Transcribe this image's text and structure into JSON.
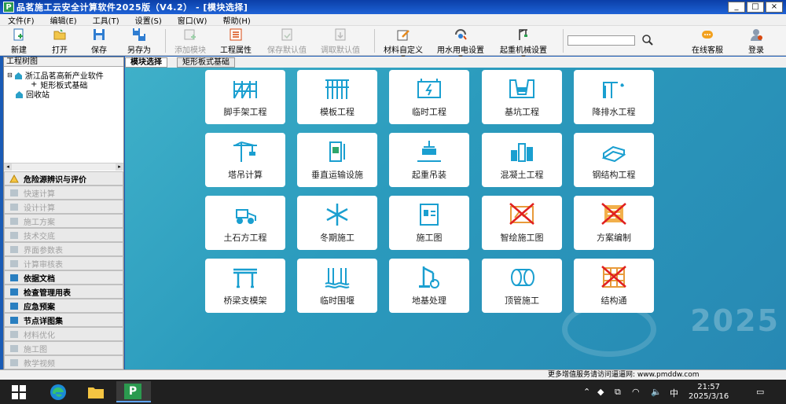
{
  "window": {
    "title": "品茗施工云安全计算软件2025版（V4.2） - [模块选择]",
    "app_icon_letter": "P",
    "minimize": "_",
    "maximize": "□",
    "close": "×"
  },
  "menu": [
    "文件(F)",
    "编辑(E)",
    "工具(T)",
    "设置(S)",
    "窗口(W)",
    "帮助(H)"
  ],
  "toolbar": {
    "new": "新建",
    "open": "打开",
    "save": "保存",
    "save_as": "另存为",
    "add_module": "添加模块",
    "project_props": "工程属性",
    "save_default": "保存默认值",
    "load_default": "调取默认值",
    "material_custom": "材料自定义",
    "water_power": "用水用电设置",
    "crane_setup": "起重机械设置",
    "search_value": "",
    "online_service": "在线客服",
    "login": "登录"
  },
  "left_panel": {
    "header": "工程树图",
    "tree": [
      "浙江品茗高新产业软件",
      "矩形板式基础",
      "回收站"
    ],
    "nav": [
      {
        "label": "危险源辨识与评价",
        "style": "bold"
      },
      {
        "label": "快速计算",
        "style": "dim"
      },
      {
        "label": "设计计算",
        "style": "dim"
      },
      {
        "label": "施工方案",
        "style": "dim"
      },
      {
        "label": "技术交底",
        "style": "dim"
      },
      {
        "label": "界面参数表",
        "style": "dim"
      },
      {
        "label": "计算审核表",
        "style": "dim"
      },
      {
        "label": "依据文档",
        "style": "bold"
      },
      {
        "label": "检查管理用表",
        "style": "bold"
      },
      {
        "label": "应急预案",
        "style": "bold"
      },
      {
        "label": "节点详图集",
        "style": "bold"
      },
      {
        "label": "材料优化",
        "style": "dim"
      },
      {
        "label": "施工图",
        "style": "dim"
      },
      {
        "label": "教学视频",
        "style": "dim"
      }
    ]
  },
  "tabs": [
    "模块选择",
    "矩形板式基础"
  ],
  "modules": [
    {
      "label": "脚手架工程",
      "icon": "scaffold-icon"
    },
    {
      "label": "模板工程",
      "icon": "formwork-icon"
    },
    {
      "label": "临时工程",
      "icon": "temporary-icon"
    },
    {
      "label": "基坑工程",
      "icon": "foundation-pit-icon"
    },
    {
      "label": "降排水工程",
      "icon": "dewatering-icon"
    },
    {
      "label": "塔吊计算",
      "icon": "tower-crane-icon"
    },
    {
      "label": "垂直运输设施",
      "icon": "hoist-icon"
    },
    {
      "label": "起重吊装",
      "icon": "lifting-icon"
    },
    {
      "label": "混凝土工程",
      "icon": "concrete-icon"
    },
    {
      "label": "钢结构工程",
      "icon": "steel-icon"
    },
    {
      "label": "土石方工程",
      "icon": "earthwork-icon"
    },
    {
      "label": "冬期施工",
      "icon": "snowflake-icon"
    },
    {
      "label": "施工图",
      "icon": "drawing-icon"
    },
    {
      "label": "智绘施工图",
      "icon": "smart-drawing-icon",
      "crossed": true
    },
    {
      "label": "方案编制",
      "icon": "plan-icon",
      "crossed": true
    },
    {
      "label": "桥梁支模架",
      "icon": "bridge-icon"
    },
    {
      "label": "临时围堰",
      "icon": "cofferdam-icon"
    },
    {
      "label": "地基处理",
      "icon": "pile-driver-icon"
    },
    {
      "label": "顶管施工",
      "icon": "pipe-jacking-icon"
    },
    {
      "label": "结构通",
      "icon": "structure-icon",
      "crossed": true
    }
  ],
  "watermark": "2025",
  "status": "更多增值服务请访问逼逼网: www.pmddw.com",
  "taskbar": {
    "ime": "中",
    "time": "21:57",
    "date": "2025/3/16"
  },
  "colors": {
    "accent": "#1e62d6",
    "tile_bg": "#ffffff",
    "main_bg": "#2b9bbd",
    "cross": "#e02020"
  }
}
